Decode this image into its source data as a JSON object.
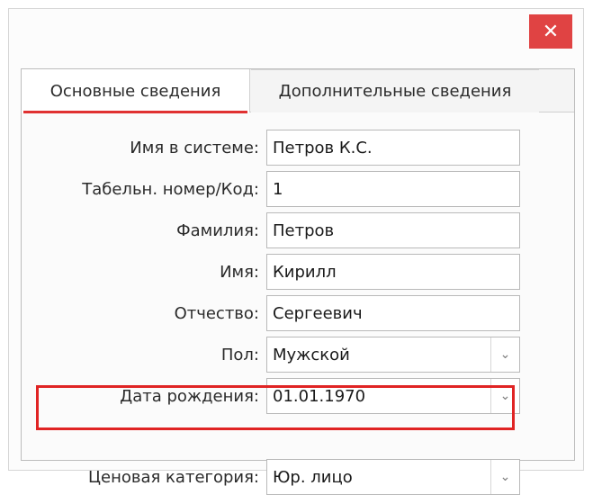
{
  "window": {
    "close_icon": "close-icon",
    "close_glyph": "✕"
  },
  "tabs": [
    {
      "label": "Основные сведения",
      "active": true
    },
    {
      "label": "Дополнительные сведения",
      "active": false
    }
  ],
  "form": {
    "fields": [
      {
        "label": "Имя в системе:",
        "value": "Петров К.С.",
        "type": "text"
      },
      {
        "label": "Табельн. номер/Код:",
        "value": "1",
        "type": "text"
      },
      {
        "label": "Фамилия:",
        "value": "Петров",
        "type": "text"
      },
      {
        "label": "Имя:",
        "value": "Кирилл",
        "type": "text"
      },
      {
        "label": "Отчество:",
        "value": "Сергеевич",
        "type": "text"
      },
      {
        "label": "Пол:",
        "value": "Мужской",
        "type": "select"
      },
      {
        "label": "Дата рождения:",
        "value": "01.01.1970",
        "type": "select"
      },
      {
        "label": "Ценовая категория:",
        "value": "Юр. лицо",
        "type": "select"
      }
    ],
    "dropdown_glyph": "⌄"
  },
  "colors": {
    "accent_red": "#e03131",
    "close_bg": "#e04343",
    "highlight": "#e02424"
  }
}
